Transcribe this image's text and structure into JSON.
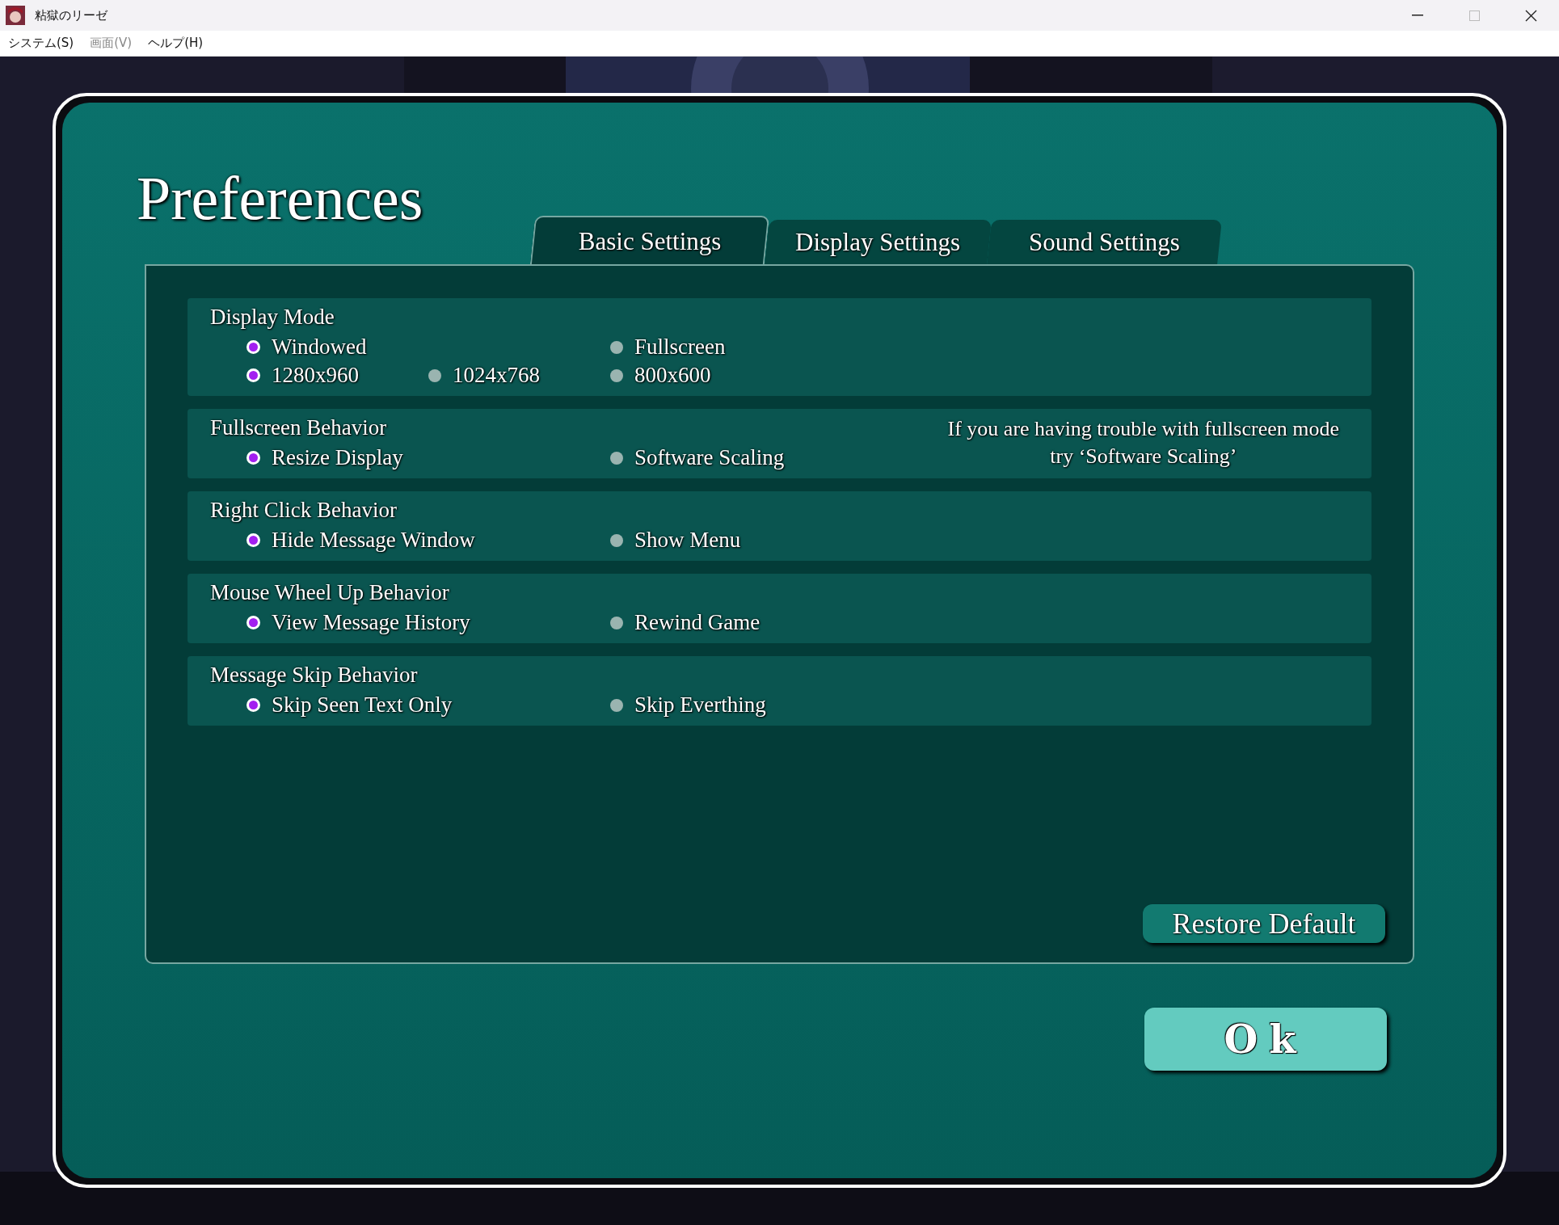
{
  "window": {
    "title": "粘獄のリーゼ"
  },
  "menu": [
    {
      "label": "システム(S)",
      "disabled": false
    },
    {
      "label": "画面(V)",
      "disabled": true
    },
    {
      "label": "ヘルプ(H)",
      "disabled": false
    }
  ],
  "preferences": {
    "title": "Preferences",
    "tabs": [
      {
        "label": "Basic Settings",
        "selected": true
      },
      {
        "label": "Display Settings",
        "selected": false
      },
      {
        "label": "Sound Settings",
        "selected": false
      }
    ],
    "groups": [
      {
        "title": "Display Mode",
        "rows": [
          [
            {
              "label": "Windowed",
              "selected": true
            },
            null,
            {
              "label": "Fullscreen",
              "selected": false
            }
          ],
          [
            {
              "label": "1280x960",
              "selected": true
            },
            {
              "label": "1024x768",
              "selected": false
            },
            {
              "label": "800x600",
              "selected": false
            }
          ]
        ]
      },
      {
        "title": "Fullscreen Behavior",
        "rows": [
          [
            {
              "label": "Resize Display",
              "selected": true
            },
            null,
            {
              "label": "Software Scaling",
              "selected": false
            }
          ]
        ],
        "note": [
          "If you are having trouble with fullscreen mode",
          "try ‘Software Scaling’"
        ]
      },
      {
        "title": "Right Click Behavior",
        "rows": [
          [
            {
              "label": "Hide Message Window",
              "selected": true
            },
            null,
            {
              "label": "Show Menu",
              "selected": false
            }
          ]
        ]
      },
      {
        "title": "Mouse Wheel Up Behavior",
        "rows": [
          [
            {
              "label": "View Message History",
              "selected": true
            },
            null,
            {
              "label": "Rewind Game",
              "selected": false
            }
          ]
        ]
      },
      {
        "title": "Message Skip Behavior",
        "rows": [
          [
            {
              "label": "Skip Seen Text Only",
              "selected": true
            },
            null,
            {
              "label": "Skip Everthing",
              "selected": false
            }
          ]
        ]
      }
    ],
    "restore_button": "Restore Default",
    "ok_button": "Ok"
  }
}
